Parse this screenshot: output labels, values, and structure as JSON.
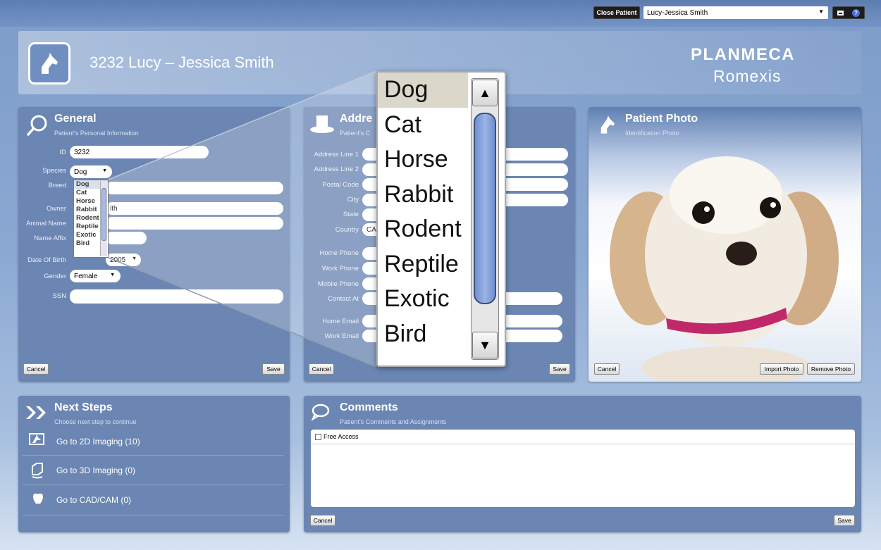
{
  "topbar": {
    "close_patient": "Close Patient",
    "patient_select": "Lucy-Jessica Smith"
  },
  "header": {
    "title": "3232 Lucy – Jessica Smith",
    "brand_line1": "PLANMECA",
    "brand_line2": "Romexis"
  },
  "general": {
    "title": "General",
    "subtitle": "Patient's Personal Information",
    "labels": {
      "id": "ID",
      "species": "Species",
      "breed": "Breed",
      "owner": "Owner",
      "animal_name": "Animal Name",
      "name_affix": "Name Affix",
      "dob": "Date Of Birth",
      "gender": "Gender",
      "ssn": "SSN"
    },
    "values": {
      "id": "3232",
      "species": "Dog",
      "owner_partial": "ith",
      "dob_partial": "2005",
      "gender": "Female"
    },
    "species_options": [
      "Dog",
      "Cat",
      "Horse",
      "Rabbit",
      "Rodent",
      "Reptile",
      "Exotic",
      "Bird"
    ],
    "cancel": "Cancel",
    "save": "Save"
  },
  "address": {
    "title_partial": "Addre",
    "subtitle_partial": "Patient's C",
    "labels": [
      "Address Line 1",
      "Address Line 2",
      "Postal Code",
      "City",
      "State",
      "Country",
      "Home Phone",
      "Work Phone",
      "Mobile Phone",
      "Contact At",
      "Home Email",
      "Work Email"
    ],
    "country_partial": "CA",
    "cancel": "Cancel",
    "save": "Save"
  },
  "photo": {
    "title": "Patient Photo",
    "subtitle": "Identification Photo",
    "cancel": "Cancel",
    "import": "Import Photo",
    "remove": "Remove Photo"
  },
  "next_steps": {
    "title": "Next Steps",
    "subtitle": "Choose next step to continue",
    "items": [
      "Go to 2D Imaging (10)",
      "Go to 3D Imaging (0)",
      "Go to CAD/CAM (0)"
    ]
  },
  "comments": {
    "title": "Comments",
    "subtitle": "Patient's Comments and Assignments",
    "free_access": "Free Access",
    "cancel": "Cancel",
    "save": "Save"
  },
  "icons": [
    "horse-icon",
    "search-icon",
    "hat-icon",
    "next-steps-icon",
    "comment-icon",
    "imaging-2d-icon",
    "imaging-3d-icon",
    "tooth-icon",
    "chevron-down-icon",
    "help-icon",
    "window-icon"
  ]
}
